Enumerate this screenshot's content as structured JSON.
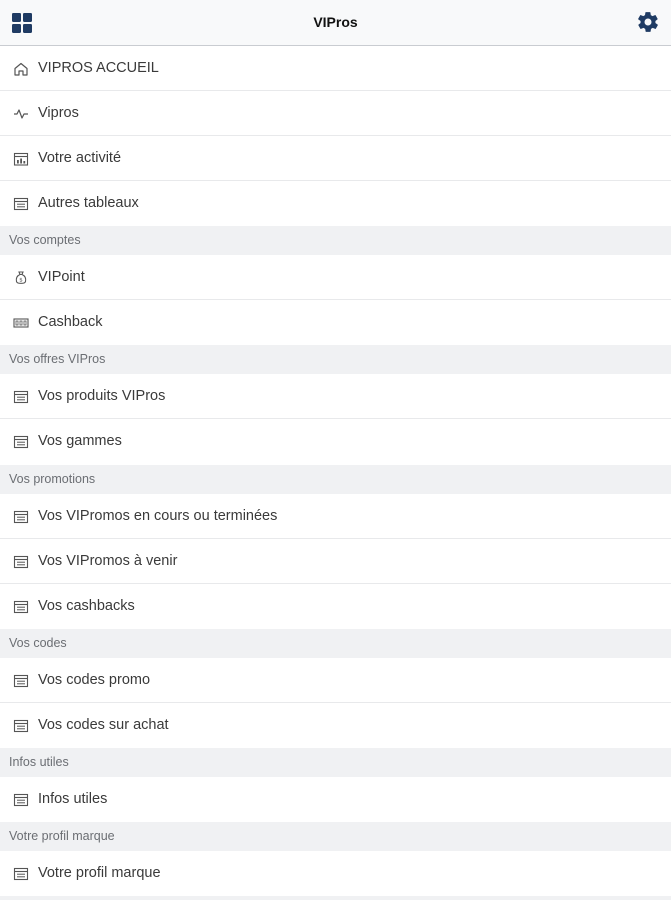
{
  "header": {
    "title": "VIPros"
  },
  "menu": {
    "accueil": "VIPROS ACCUEIL",
    "vipros": "Vipros",
    "activite": "Votre activité",
    "autres_tableaux": "Autres tableaux",
    "vipoint": "VIPoint",
    "cashback": "Cashback",
    "produits": "Vos produits VIPros",
    "gammes": "Vos gammes",
    "vipromos_cours": "Vos VIPromos en cours ou terminées",
    "vipromos_venir": "Vos VIPromos à venir",
    "cashbacks": "Vos cashbacks",
    "codes_promo": "Vos codes promo",
    "codes_achat": "Vos codes sur achat",
    "infos_utiles": "Infos utiles",
    "profil_marque": "Votre profil marque"
  },
  "sections": {
    "comptes": "Vos comptes",
    "offres": "Vos offres VIPros",
    "promotions": "Vos promotions",
    "codes": "Vos codes",
    "infos": "Infos utiles",
    "profil": "Votre profil marque"
  },
  "colors": {
    "accent": "#1f3b63",
    "text": "#3a3a3a",
    "section_bg": "#f0f1f3"
  }
}
